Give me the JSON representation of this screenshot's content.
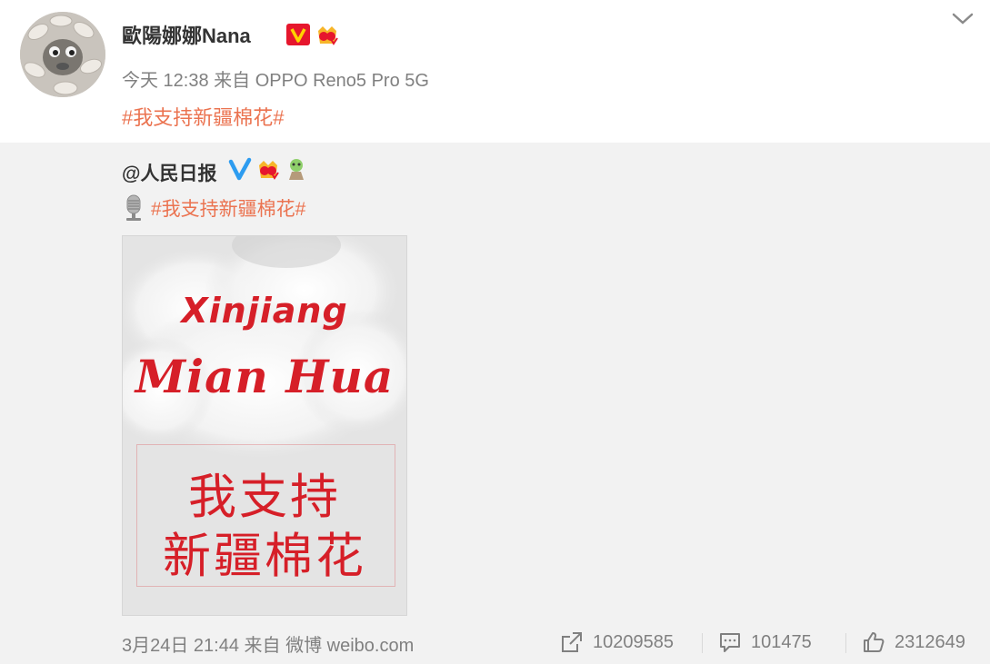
{
  "post": {
    "author": "歐陽娜娜Nana",
    "badges": [
      "v-verified-icon",
      "crown-badge-icon"
    ],
    "time": "今天 12:38",
    "source": "来自 OPPO Reno5 Pro 5G",
    "topic": "#我支持新疆棉花#"
  },
  "repost": {
    "author": "@人民日报",
    "badges": [
      "blue-v-verified-icon",
      "crown-badge-icon",
      "mascot-badge-icon"
    ],
    "topic": "#我支持新疆棉花#",
    "image": {
      "line1": "Xinjiang",
      "line2": "Mian Hua",
      "line3": "我支持",
      "line4": "新疆棉花"
    },
    "time": "3月24日 21:44",
    "source": "来自 微博 weibo.com",
    "shares": "10209585",
    "comments": "101475",
    "likes": "2312649"
  },
  "colors": {
    "topic": "#eb7350",
    "poster_red": "#d61f28",
    "meta_gray": "#808080",
    "repost_bg": "#f2f2f2"
  }
}
